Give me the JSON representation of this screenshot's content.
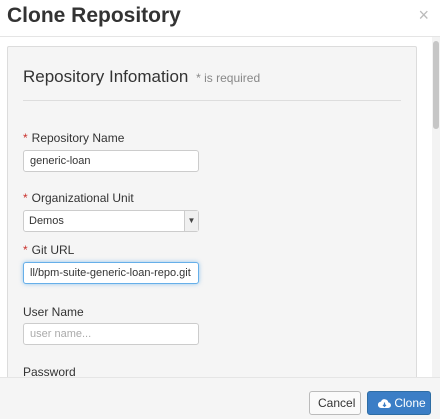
{
  "modal": {
    "title": "Clone Repository",
    "close_glyph": "×"
  },
  "form": {
    "legend": "Repository Infomation",
    "required_note": "* is required",
    "required_marker": "*",
    "repository_name": {
      "label": "Repository Name",
      "value": "generic-loan",
      "required": true
    },
    "organizational_unit": {
      "label": "Organizational Unit",
      "selected": "Demos",
      "required": true
    },
    "git_url": {
      "label": "Git URL",
      "value": "ll/bpm-suite-generic-loan-repo.git",
      "required": true
    },
    "user_name": {
      "label": "User Name",
      "value": "",
      "placeholder": "user name..."
    },
    "password": {
      "label": "Password"
    }
  },
  "footer": {
    "cancel_label": "Cancel",
    "clone_label": "Clone",
    "clone_icon": "cloud-download-icon"
  },
  "colors": {
    "primary": "#3b7ec6",
    "required": "#c9302c",
    "focus": "#66afe9"
  }
}
